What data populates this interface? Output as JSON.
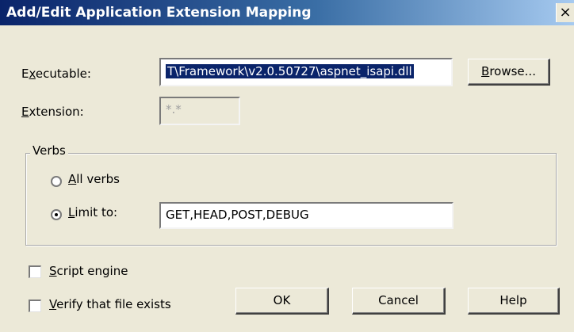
{
  "window": {
    "title": "Add/Edit Application Extension Mapping",
    "close_icon": "close-icon",
    "close_glyph": "×"
  },
  "form": {
    "executable_label_pre": "E",
    "executable_label_key": "x",
    "executable_label_post": "ecutable:",
    "executable_value": "T\\Framework\\v2.0.50727\\aspnet_isapi.dll",
    "browse_key": "B",
    "browse_rest": "rowse...",
    "extension_label_key": "E",
    "extension_label_post": "xtension:",
    "extension_value": "*.*"
  },
  "verbs": {
    "group_label": "Verbs",
    "all_key": "A",
    "all_rest": "ll verbs",
    "all_checked": false,
    "limit_key": "L",
    "limit_rest": "imit to:",
    "limit_checked": true,
    "limit_value": "GET,HEAD,POST,DEBUG"
  },
  "options": {
    "script_key": "S",
    "script_rest": "cript engine",
    "script_checked": false,
    "verify_key": "V",
    "verify_rest": "erify that file exists",
    "verify_checked": false
  },
  "buttons": {
    "ok": "OK",
    "cancel": "Cancel",
    "help": "Help"
  },
  "colors": {
    "title_bar_start": "#0a246a",
    "title_bar_end": "#a6caf0",
    "dialog_bg": "#ece9d8",
    "selection": "#0a246a"
  }
}
